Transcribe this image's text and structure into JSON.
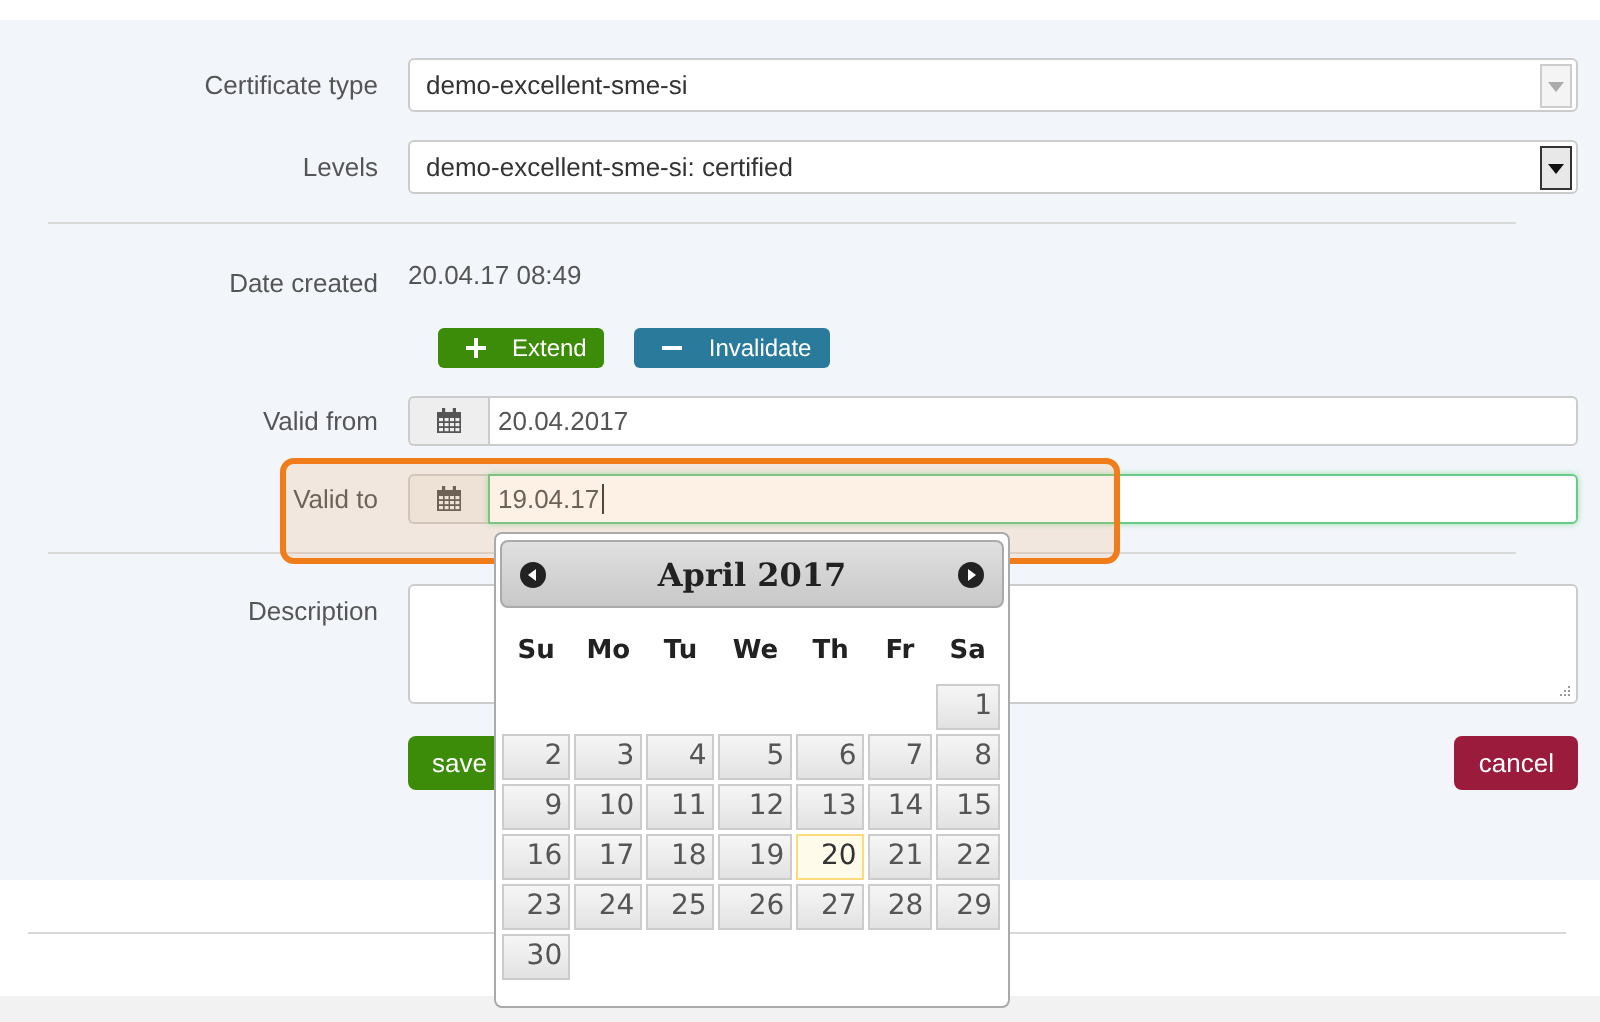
{
  "form": {
    "certificate_type": {
      "label": "Certificate type",
      "value": "demo-excellent-sme-si",
      "disabled": true
    },
    "levels": {
      "label": "Levels",
      "value": "demo-excellent-sme-si: certified",
      "disabled": false
    },
    "date_created": {
      "label": "Date created",
      "value": "20.04.17 08:49"
    },
    "actions": [
      {
        "label": "Extend",
        "kind": "extend"
      },
      {
        "label": "Invalidate",
        "kind": "invalidate"
      }
    ],
    "valid_from": {
      "label": "Valid from",
      "value": "20.04.2017",
      "focused": false
    },
    "valid_to": {
      "label": "Valid to",
      "value": "19.04.17",
      "focused": true
    },
    "description": {
      "label": "Description"
    },
    "save": "save",
    "cancel": "cancel"
  },
  "datepicker": {
    "title": "April 2017",
    "weekdays": [
      "Su",
      "Mo",
      "Tu",
      "We",
      "Th",
      "Fr",
      "Sa"
    ],
    "weeks": [
      {
        "kind": "trailing",
        "days": [
          {
            "label": "1",
            "highlighted": false
          }
        ]
      },
      {
        "kind": "full",
        "days": [
          {
            "label": "2",
            "highlighted": false
          },
          {
            "label": "3",
            "highlighted": false
          },
          {
            "label": "4",
            "highlighted": false
          },
          {
            "label": "5",
            "highlighted": false
          },
          {
            "label": "6",
            "highlighted": false
          },
          {
            "label": "7",
            "highlighted": false
          },
          {
            "label": "8",
            "highlighted": false
          }
        ]
      },
      {
        "kind": "full",
        "days": [
          {
            "label": "9",
            "highlighted": false
          },
          {
            "label": "10",
            "highlighted": false
          },
          {
            "label": "11",
            "highlighted": false
          },
          {
            "label": "12",
            "highlighted": false
          },
          {
            "label": "13",
            "highlighted": false
          },
          {
            "label": "14",
            "highlighted": false
          },
          {
            "label": "15",
            "highlighted": false
          }
        ]
      },
      {
        "kind": "full",
        "days": [
          {
            "label": "16",
            "highlighted": false
          },
          {
            "label": "17",
            "highlighted": false
          },
          {
            "label": "18",
            "highlighted": false
          },
          {
            "label": "19",
            "highlighted": false
          },
          {
            "label": "20",
            "highlighted": true
          },
          {
            "label": "21",
            "highlighted": false
          },
          {
            "label": "22",
            "highlighted": false
          }
        ]
      },
      {
        "kind": "full",
        "days": [
          {
            "label": "23",
            "highlighted": false
          },
          {
            "label": "24",
            "highlighted": false
          },
          {
            "label": "25",
            "highlighted": false
          },
          {
            "label": "26",
            "highlighted": false
          },
          {
            "label": "27",
            "highlighted": false
          },
          {
            "label": "28",
            "highlighted": false
          },
          {
            "label": "29",
            "highlighted": false
          }
        ]
      },
      {
        "kind": "leading",
        "days": [
          {
            "label": "30",
            "highlighted": false
          }
        ]
      }
    ]
  }
}
